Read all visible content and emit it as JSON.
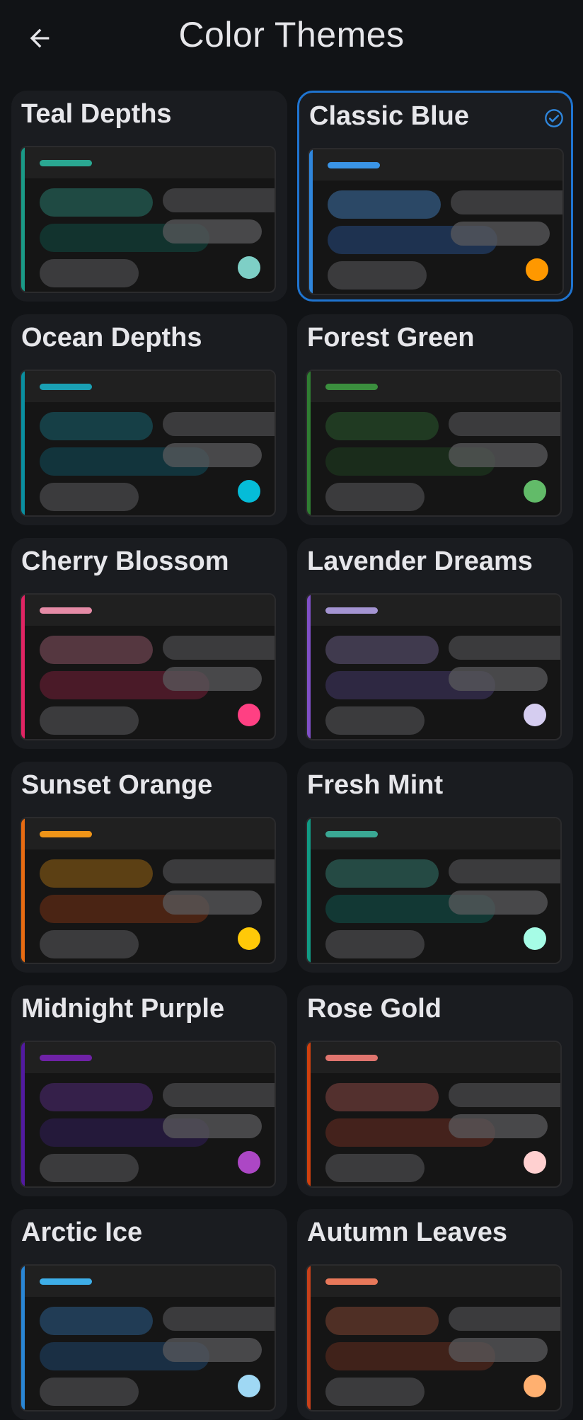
{
  "header": {
    "title": "Color Themes",
    "back_icon": "arrow-left-icon"
  },
  "selected_theme": "Classic Blue",
  "themes": [
    {
      "name": "Teal Depths",
      "stripe": "#1a9a87",
      "accent": "#2aa892",
      "p1": "#1f4a43",
      "p2": "#12332e",
      "dot": "#7ecfc6",
      "selected": false
    },
    {
      "name": "Classic Blue",
      "stripe": "#2f86dc",
      "accent": "#3a94e6",
      "p1": "#2b4866",
      "p2": "#1e3250",
      "dot": "#ff9800",
      "selected": true
    },
    {
      "name": "Ocean Depths",
      "stripe": "#0a8fa0",
      "accent": "#1aa0b4",
      "p1": "#163f46",
      "p2": "#12343c",
      "dot": "#05bcd8",
      "selected": false
    },
    {
      "name": "Forest Green",
      "stripe": "#2f7d32",
      "accent": "#3b8f3e",
      "p1": "#203a22",
      "p2": "#1a2c1b",
      "dot": "#62bb69",
      "selected": false
    },
    {
      "name": "Cherry Blossom",
      "stripe": "#e02463",
      "accent": "#e58ba6",
      "p1": "#553740",
      "p2": "#4a1a28",
      "dot": "#ff4083",
      "selected": false
    },
    {
      "name": "Lavender Dreams",
      "stripe": "#8050c8",
      "accent": "#a494d2",
      "p1": "#403a4e",
      "p2": "#2e2842",
      "dot": "#d5cdf0",
      "selected": false
    },
    {
      "name": "Sunset Orange",
      "stripe": "#e76b12",
      "accent": "#ef9418",
      "p1": "#5c4014",
      "p2": "#4a2414",
      "dot": "#ffc908",
      "selected": false
    },
    {
      "name": "Fresh Mint",
      "stripe": "#109b85",
      "accent": "#3aa894",
      "p1": "#254a44",
      "p2": "#123834",
      "dot": "#a6fce6",
      "selected": false
    },
    {
      "name": "Midnight Purple",
      "stripe": "#521aa0",
      "accent": "#6f22a6",
      "p1": "#35204a",
      "p2": "#24193a",
      "dot": "#ac47c5",
      "selected": false
    },
    {
      "name": "Rose Gold",
      "stripe": "#d0400e",
      "accent": "#e0756e",
      "p1": "#53302e",
      "p2": "#44221c",
      "dot": "#ffd0d0",
      "selected": false
    },
    {
      "name": "Arctic Ice",
      "stripe": "#2a86d4",
      "accent": "#3eaee8",
      "p1": "#213c55",
      "p2": "#1a2f44",
      "dot": "#9fd8f4",
      "selected": false
    },
    {
      "name": "Autumn Leaves",
      "stripe": "#c8401a",
      "accent": "#e8785a",
      "p1": "#4f2f25",
      "p2": "#40221a",
      "dot": "#ffb070",
      "selected": false
    }
  ]
}
